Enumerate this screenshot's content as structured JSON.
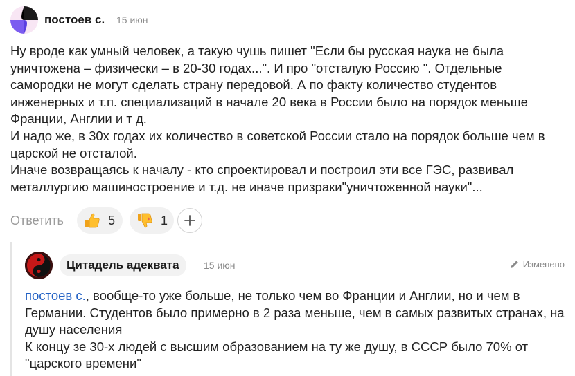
{
  "comment": {
    "author": "постоев с.",
    "date": "15 июн",
    "avatar_icon": "gradient-avatar-icon",
    "paragraphs": [
      "Ну вроде как умный человек, а такую чушь пишет \"Если бы русская наука не была уничтожена – физически – в 20-30 годах...\". И про \"отсталую Россию \". Отдельные самородки не могут сделать страну передовой. А по факту количество студентов инженерных и т.п. специализаций в начале 20 века в России было на порядок меньше Франции, Англии и т д.",
      "И надо же, в 30х годах их количество в советской России стало на порядок больше чем в царской не отсталой.",
      "Иначе возвращаясь к началу - кто спроектировал и построил эти все ГЭС, развивал металлургию машиностроение и т.д. не иначе призраки\"уничтоженной науки\"..."
    ]
  },
  "actions": {
    "reply_label": "Ответить",
    "like_icon": "thumbs-up-emoji-icon",
    "like_count": "5",
    "dislike_icon": "thumbs-down-emoji-icon",
    "dislike_count": "1",
    "add_icon": "plus-icon"
  },
  "reply": {
    "author": "Цитадель адеквата",
    "date": "15 июн",
    "avatar_icon": "yin-yang-avatar-icon",
    "edited_icon": "pencil-icon",
    "edited_label": "Изменено",
    "mention": "постоев с.",
    "first_line_rest": ", вообще-то уже больше, не только чем во Франции и Англии, но и чем в Германии. Студентов было примерно в 2 раза меньше, чем в самых развитых странах, на душу населения",
    "paragraphs": [
      "К концу зе 30-х людей с высшим образованием на ту же душу, в СССР было 70% от \"царского времени\""
    ]
  },
  "colors": {
    "mention": "#2160c4",
    "pill_bg": "#f1f1f1",
    "muted": "#8a8a8a"
  }
}
